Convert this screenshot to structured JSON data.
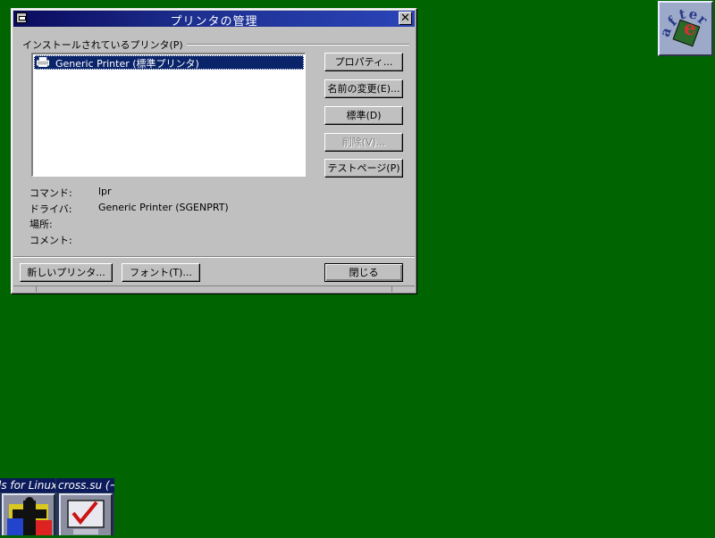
{
  "window": {
    "title": "プリンタの管理",
    "group_label": "インストールされているプリンタ(P)",
    "printers": [
      {
        "label": "Generic Printer (標準プリンタ)",
        "selected": true
      }
    ],
    "buttons": {
      "properties": "プロパティ...",
      "rename": "名前の変更(E)...",
      "default": "標準(D)",
      "delete": "削除(V)...",
      "test_page": "テストページ(P)",
      "new_printer": "新しいプリンタ...",
      "font": "フォント(T)...",
      "close": "閉じる"
    },
    "info": {
      "command_label": "コマンド:",
      "command_value": "lpr",
      "driver_label": "ドライバ:",
      "driver_value": "Generic Printer (SGENPRT)",
      "location_label": "場所:",
      "location_value": "",
      "comment_label": "コメント:",
      "comment_value": ""
    }
  },
  "desktop": {
    "background_color": "#006400",
    "afterstep_icon_letters": "after"
  },
  "taskbar": {
    "tasks": [
      {
        "label": "ls for Linux"
      },
      {
        "label": "cross.su (~)"
      }
    ]
  }
}
